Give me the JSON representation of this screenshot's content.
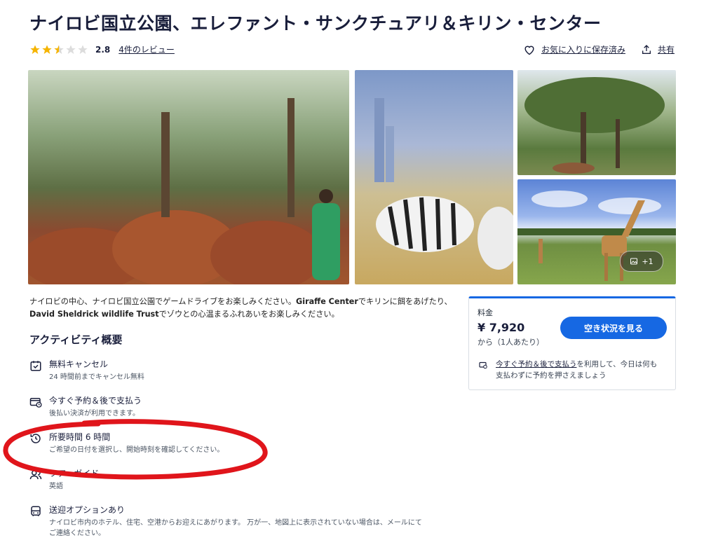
{
  "title": "ナイロビ国立公園、エレファント・サンクチュアリ＆キリン・センター",
  "rating": {
    "stars": 2.8,
    "value": "2.8",
    "reviews_link": "4件のレビュー"
  },
  "actions": {
    "save_label": "お気に入りに保存済み",
    "share_label": "共有"
  },
  "gallery": {
    "more_label": "+1"
  },
  "description": {
    "part1": "ナイロビの中心、ナイロビ国立公園でゲームドライブをお楽しみください。",
    "bold1": "Giraffe Center",
    "part2": "でキリンに餌をあげたり、",
    "bold2": "David Sheldrick wildlife Trust",
    "part3": "でゾウとの心温まるふれあいをお楽しみください。"
  },
  "overview": {
    "title": "アクティビティ概要",
    "features": [
      {
        "icon": "calendar-check-icon",
        "title": "無料キャンセル",
        "sub": "24 時間前までキャンセル無料",
        "sub2": ""
      },
      {
        "icon": "wallet-clock-icon",
        "title": "今すぐ予約＆後で支払う",
        "sub": "後払い決済が利用できます。",
        "sub2": ""
      },
      {
        "icon": "clock-history-icon",
        "title": "所要時間 6 時間",
        "sub": "ご希望の日付を選択し、開始時刻を確認してください。",
        "sub2": ""
      },
      {
        "icon": "people-icon",
        "title": "ツアーガイド",
        "sub": "英語",
        "sub2": ""
      },
      {
        "icon": "bus-icon",
        "title": "送迎オプションあり",
        "sub": "ナイロビ市内のホテル、住宅、空港からお迎えにあがります。 万が一、地図上に表示されていない場合は、メールにて",
        "sub2": "ご連絡ください。"
      }
    ]
  },
  "price_card": {
    "label": "料金",
    "price": "¥ 7,920",
    "per": "から（1人あたり）",
    "button": "空き状況を見る",
    "note_link": "今すぐ予約＆後で支払う",
    "note_text1": "を利用して、今日は何も",
    "note_text2": "支払わずに予約を押さえましょう"
  },
  "colors": {
    "accent": "#1668e3",
    "star": "#f5b400",
    "annotation": "#e0151b"
  }
}
